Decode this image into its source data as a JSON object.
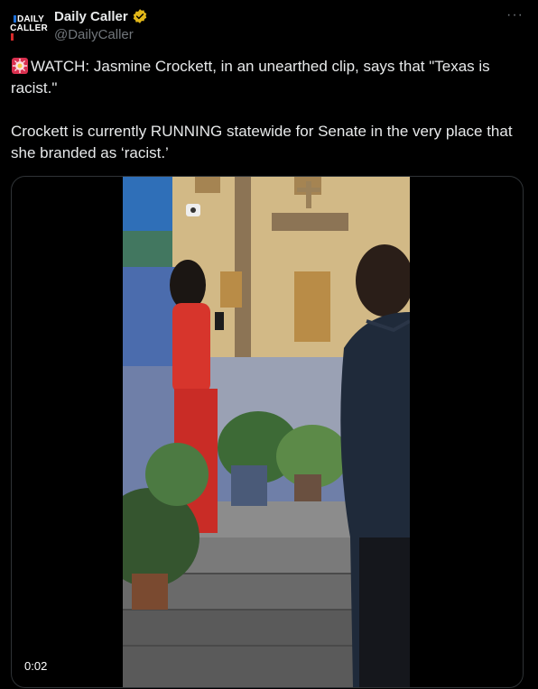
{
  "account": {
    "avatar_line1": "DAILY",
    "avatar_line2": "CALLER",
    "name": "Daily Caller",
    "handle": "@DailyCaller",
    "verified_badge": "gold-check-badge-icon",
    "more_label": "···"
  },
  "tweet": {
    "line1": "WATCH: Jasmine Crockett, in an unearthed clip, says that \"Texas is racist.\"",
    "line2": "Crockett is currently RUNNING statewide for Senate in the very place that she branded as ‘racist.’",
    "siren_icon": "siren-emoji-icon"
  },
  "video": {
    "timestamp": "0:02"
  },
  "colors": {
    "background": "#000000",
    "text": "#e7e9ea",
    "secondary": "#71767b",
    "border": "#2f3336",
    "verified_gold": "#e2b719"
  }
}
